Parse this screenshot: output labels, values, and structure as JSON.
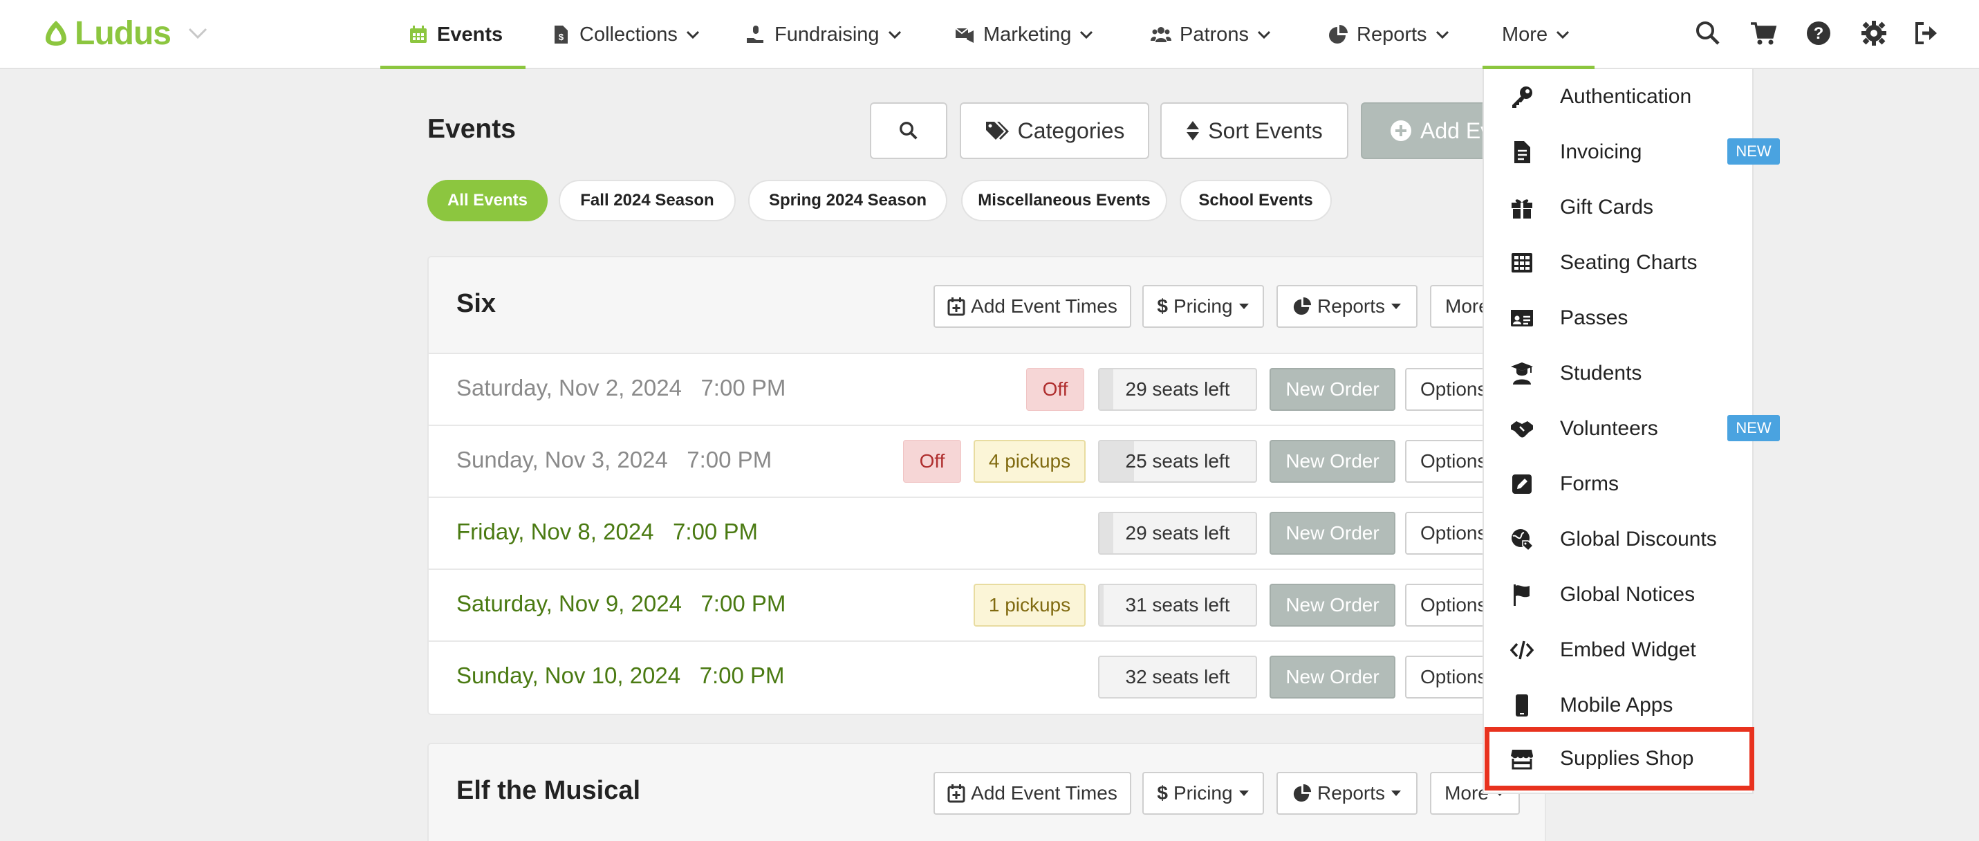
{
  "app": {
    "logo_text": "Ludus"
  },
  "nav": {
    "items": [
      {
        "label": "Events",
        "icon": "calendar-icon",
        "active": true
      },
      {
        "label": "Collections",
        "icon": "money-doc-icon"
      },
      {
        "label": "Fundraising",
        "icon": "donate-hand-icon"
      },
      {
        "label": "Marketing",
        "icon": "mail-bullhorn-icon"
      },
      {
        "label": "Patrons",
        "icon": "users-icon"
      },
      {
        "label": "Reports",
        "icon": "pie-chart-icon"
      },
      {
        "label": "More",
        "icon": "",
        "open": true
      }
    ],
    "right_icons": [
      "search-icon",
      "cart-icon",
      "help-icon",
      "gear-icon",
      "sign-out-icon"
    ]
  },
  "page": {
    "title": "Events",
    "search_button_icon": "search-icon",
    "categories_label": "Categories",
    "sort_label": "Sort Events",
    "add_label": "Add Ev"
  },
  "filters": [
    "All Events",
    "Fall 2024 Season",
    "Spring 2024 Season",
    "Miscellaneous Events",
    "School Events"
  ],
  "active_filter": "All Events",
  "cards": [
    {
      "title": "Six",
      "buttons": {
        "add_times": "Add Event Times",
        "pricing": "Pricing",
        "reports": "Reports",
        "more": "More"
      },
      "rows": [
        {
          "date": "Saturday, Nov 2, 2024",
          "time": "7:00 PM",
          "status": "past",
          "off": "Off",
          "pickups": "",
          "seats": "29 seats left",
          "new_order": "New Order",
          "options": "Options"
        },
        {
          "date": "Sunday, Nov 3, 2024",
          "time": "7:00 PM",
          "status": "past",
          "off": "Off",
          "pickups": "4 pickups",
          "seats": "25 seats left",
          "new_order": "New Order",
          "options": "Options"
        },
        {
          "date": "Friday, Nov 8, 2024",
          "time": "7:00 PM",
          "status": "future",
          "off": "",
          "pickups": "",
          "seats": "29 seats left",
          "new_order": "New Order",
          "options": "Options"
        },
        {
          "date": "Saturday, Nov 9, 2024",
          "time": "7:00 PM",
          "status": "future",
          "off": "",
          "pickups": "1 pickups",
          "seats": "31 seats left",
          "new_order": "New Order",
          "options": "Options"
        },
        {
          "date": "Sunday, Nov 10, 2024",
          "time": "7:00 PM",
          "status": "future",
          "off": "",
          "pickups": "",
          "seats": "32 seats left",
          "new_order": "New Order",
          "options": "Options"
        }
      ]
    },
    {
      "title": "Elf the Musical",
      "buttons": {
        "add_times": "Add Event Times",
        "pricing": "Pricing",
        "reports": "Reports",
        "more": "More"
      },
      "rows": []
    }
  ],
  "more_menu": {
    "items": [
      {
        "label": "Authentication",
        "icon": "key-icon"
      },
      {
        "label": "Invoicing",
        "icon": "invoice-icon",
        "badge": "NEW"
      },
      {
        "label": "Gift Cards",
        "icon": "gift-icon"
      },
      {
        "label": "Seating Charts",
        "icon": "grid-table-icon"
      },
      {
        "label": "Passes",
        "icon": "id-card-icon"
      },
      {
        "label": "Students",
        "icon": "graduate-icon"
      },
      {
        "label": "Volunteers",
        "icon": "handshake-icon",
        "badge": "NEW"
      },
      {
        "label": "Forms",
        "icon": "edit-square-icon"
      },
      {
        "label": "Global Discounts",
        "icon": "globe-tag-icon"
      },
      {
        "label": "Global Notices",
        "icon": "flag-icon"
      },
      {
        "label": "Embed Widget",
        "icon": "code-icon"
      },
      {
        "label": "Mobile Apps",
        "icon": "mobile-phone-icon"
      },
      {
        "label": "Supplies Shop",
        "icon": "store-icon",
        "highlighted": true
      }
    ]
  },
  "colors": {
    "brand_green": "#8cc63f",
    "highlight_red": "#e8321e",
    "badge_blue": "#4aa3e0"
  }
}
